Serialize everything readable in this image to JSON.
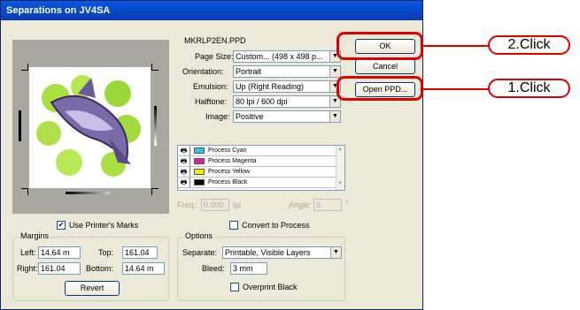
{
  "window": {
    "title": "Separations on JV4SA"
  },
  "ppd_name": "MKRLP2EN.PPD",
  "fields": {
    "page_size": {
      "label": "Page Size:",
      "value": "Custom... (498 x 498 p..."
    },
    "orientation": {
      "label": "Orientation:",
      "value": "Portrait"
    },
    "emulsion": {
      "label": "Emulsion:",
      "value": "Up (Right Reading)"
    },
    "halftone": {
      "label": "Halftone:",
      "value": "80 lpi / 600 dpi"
    },
    "image": {
      "label": "Image:",
      "value": "Positive"
    }
  },
  "buttons": {
    "ok": "OK",
    "cancel": "Cancel",
    "open_ppd": "Open PPD...",
    "revert": "Revert"
  },
  "inks": [
    {
      "name": "Process Cyan",
      "color": "#30c0e8"
    },
    {
      "name": "Process Magenta",
      "color": "#e020a0"
    },
    {
      "name": "Process Yellow",
      "color": "#f0f000"
    },
    {
      "name": "Process Black",
      "color": "#000000"
    }
  ],
  "freq": {
    "label": "Freq.:",
    "value": "0.000",
    "unit": "lpi"
  },
  "angle": {
    "label": "Angle:",
    "value": "0",
    "unit": "°"
  },
  "convert_to_process": {
    "label": "Convert to Process",
    "checked": false
  },
  "use_printers_marks": {
    "label": "Use Printer's Marks",
    "checked": true
  },
  "margins": {
    "title": "Margins",
    "left_label": "Left:",
    "left": "14.64 m",
    "top_label": "Top:",
    "top": "161.04",
    "right_label": "Right:",
    "right": "161.04",
    "bottom_label": "Bottom:",
    "bottom": "14.64 m"
  },
  "options": {
    "title": "Options",
    "separate_label": "Separate:",
    "separate": "Printable, Visible Layers",
    "bleed_label": "Bleed:",
    "bleed": "3 mm",
    "overprint_label": "Overprint Black",
    "overprint_checked": false
  },
  "callouts": {
    "click2": "2.Click",
    "click1": "1.Click",
    "color": "#e00000"
  }
}
